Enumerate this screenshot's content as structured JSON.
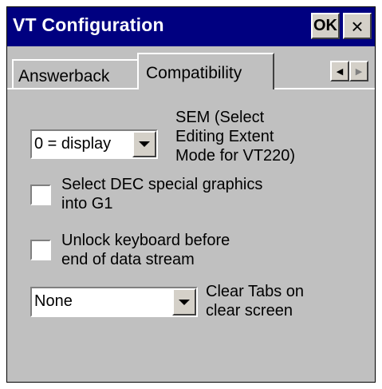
{
  "window": {
    "title": "VT Configuration",
    "ok_label": "OK",
    "close_label": "×"
  },
  "tabs": [
    {
      "label": "Answerback",
      "selected": false
    },
    {
      "label": "Compatibility",
      "selected": true
    }
  ],
  "tab_scroll": {
    "left_label": "◀",
    "right_label": "▶"
  },
  "compatibility": {
    "sem_select_value": "0 = display",
    "sem_label_line1": "SEM (Select",
    "sem_label_line2": "Editing Extent",
    "sem_label_line3": "Mode for VT220)",
    "dec_checkbox": {
      "line1": "Select DEC special graphics",
      "line2": "into G1",
      "checked": false
    },
    "unlock_checkbox": {
      "line1": "Unlock keyboard before",
      "line2": "end of data stream",
      "checked": false
    },
    "clear_tabs_value": "None",
    "clear_tabs_line1": "Clear Tabs on",
    "clear_tabs_line2": "clear screen"
  }
}
